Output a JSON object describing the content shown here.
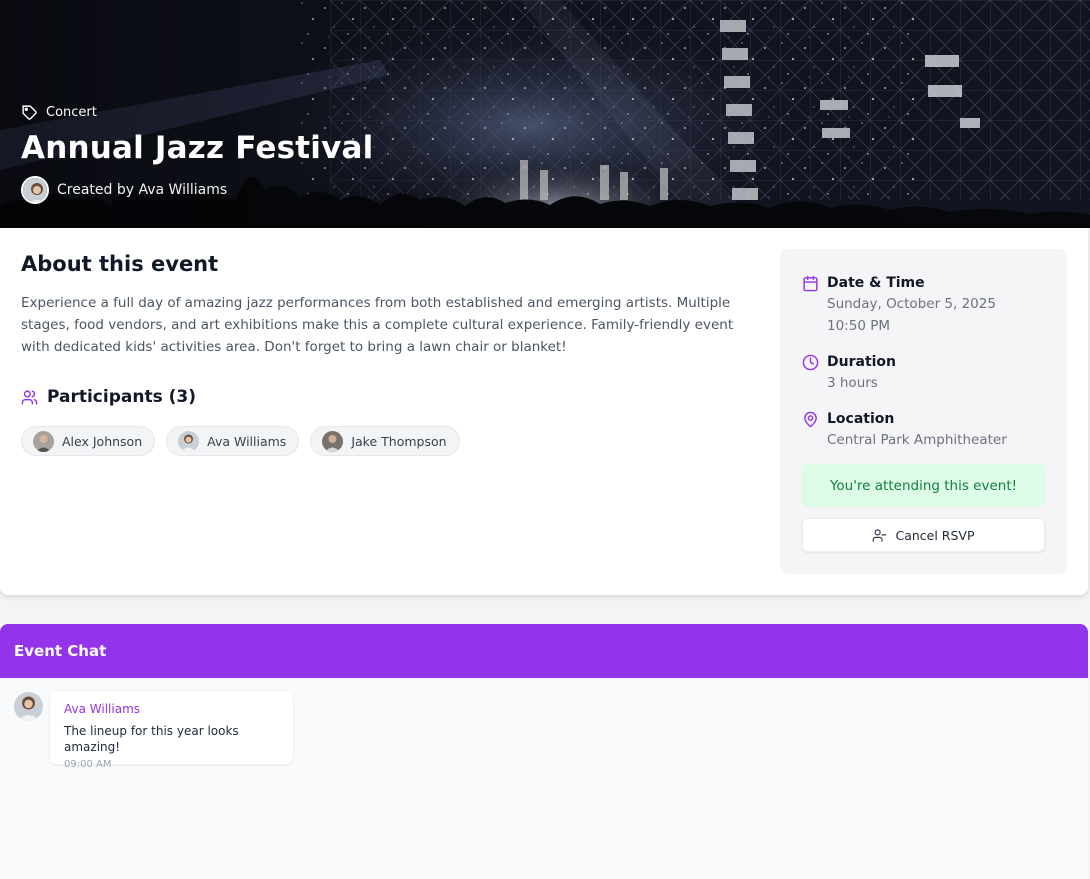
{
  "event": {
    "category": "Concert",
    "title": "Annual Jazz Festival",
    "creator_text": "Created by Ava Williams"
  },
  "about": {
    "heading": "About this event",
    "description": "Experience a full day of amazing jazz performances from both established and emerging artists. Multiple stages, food vendors, and art exhibitions make this a complete cultural experience. Family-friendly event with dedicated kids' activities area. Don't forget to bring a lawn chair or blanket!"
  },
  "participants": {
    "heading": "Participants (3)",
    "list": [
      {
        "name": "Alex Johnson"
      },
      {
        "name": "Ava Williams"
      },
      {
        "name": "Jake Thompson"
      }
    ]
  },
  "details": {
    "date_label": "Date & Time",
    "date_value": "Sunday, October 5, 2025",
    "time_value": "10:50 PM",
    "duration_label": "Duration",
    "duration_value": "3 hours",
    "location_label": "Location",
    "location_value": "Central Park Amphitheater",
    "attending_text": "You're attending this event!",
    "cancel_label": "Cancel RSVP"
  },
  "chat": {
    "title": "Event Chat",
    "messages": [
      {
        "author": "Ava Williams",
        "text": "The lineup for this year looks amazing!",
        "time": "09:00 AM"
      }
    ]
  },
  "colors": {
    "accent": "#9333ea",
    "attending_bg": "#dcfce7",
    "attending_text": "#15803d"
  },
  "icons": {
    "category": "tag-icon",
    "participants": "users-icon",
    "date": "calendar-icon",
    "duration": "clock-icon",
    "location": "map-pin-icon",
    "cancel": "user-minus-icon"
  }
}
